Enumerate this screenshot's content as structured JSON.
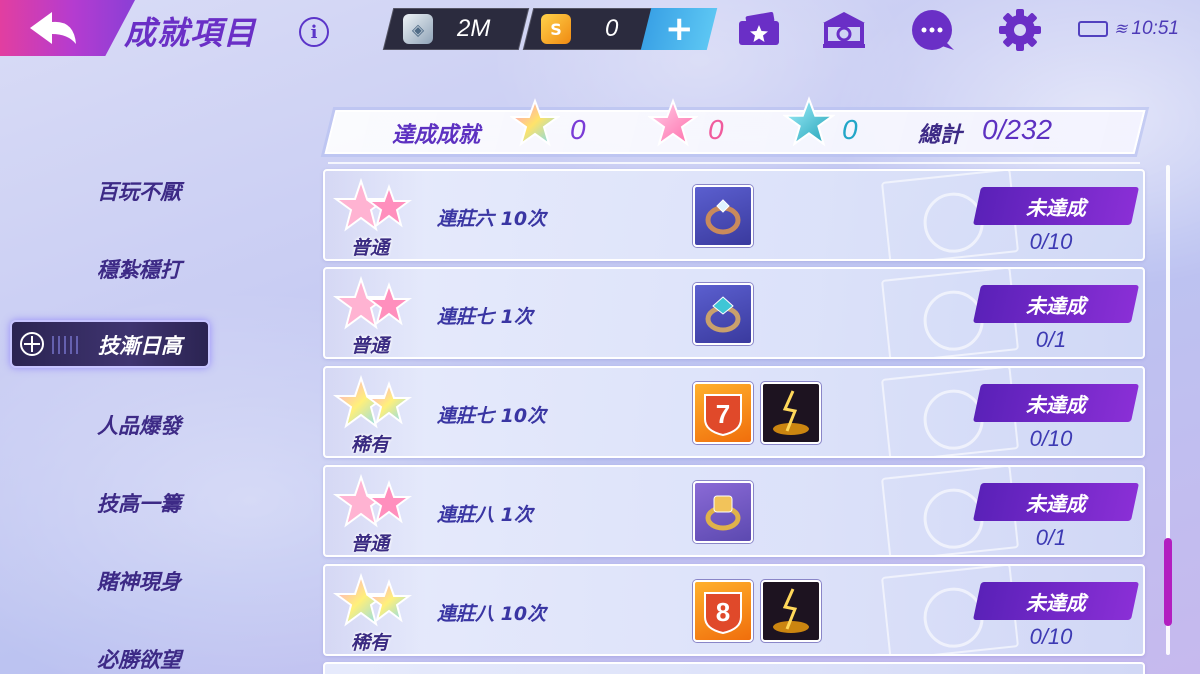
{
  "header": {
    "title": "成就項目",
    "back_icon": "back-arrow-icon",
    "info_icon": "info-icon"
  },
  "currency": {
    "silver": {
      "icon": "silver-gem-icon",
      "value": "2M"
    },
    "gold": {
      "icon": "gold-coin-icon",
      "value": "0"
    },
    "add_label": "+"
  },
  "toolbar_icons": [
    "ticket-star-icon",
    "bank-icon",
    "chat-bubble-icon",
    "gear-icon"
  ],
  "status_bar": {
    "time": "10:51",
    "battery_icon": "battery-icon",
    "wifi_icon": "wifi-icon"
  },
  "summary": {
    "label": "達成成就",
    "counts": [
      {
        "icon": "rainbow-star-icon",
        "value": "0",
        "color": "#7a3bd6"
      },
      {
        "icon": "pink-star-icon",
        "value": "0",
        "color": "#f05b9d"
      },
      {
        "icon": "teal-star-icon",
        "value": "0",
        "color": "#22a6c8"
      }
    ],
    "total_label": "總計",
    "total_value": "0/232"
  },
  "menu": {
    "items": [
      "百玩不厭",
      "穩紮穩打",
      "技漸日高",
      "人品爆發",
      "技高一籌",
      "賭神現身",
      "必勝欲望"
    ],
    "active_index": 2
  },
  "achievements": [
    {
      "rarity": "普通",
      "task": "連莊六 10次",
      "rewards": [
        "silver-ring-icon"
      ],
      "status": "未達成",
      "progress": "0/10"
    },
    {
      "rarity": "普通",
      "task": "連莊七 1次",
      "rewards": [
        "gem-ring-icon"
      ],
      "status": "未達成",
      "progress": "0/1"
    },
    {
      "rarity": "稀有",
      "task": "連莊七 10次",
      "rewards": [
        "number-7-badge-icon",
        "lightning-effect-icon"
      ],
      "status": "未達成",
      "progress": "0/10"
    },
    {
      "rarity": "普通",
      "task": "連莊八 1次",
      "rewards": [
        "gold-ring-icon"
      ],
      "status": "未達成",
      "progress": "0/1"
    },
    {
      "rarity": "稀有",
      "task": "連莊八 10次",
      "rewards": [
        "number-8-badge-icon",
        "lightning-effect-icon"
      ],
      "status": "未達成",
      "progress": "0/10"
    }
  ],
  "badge_numbers": {
    "seven": "7",
    "eight": "8"
  }
}
